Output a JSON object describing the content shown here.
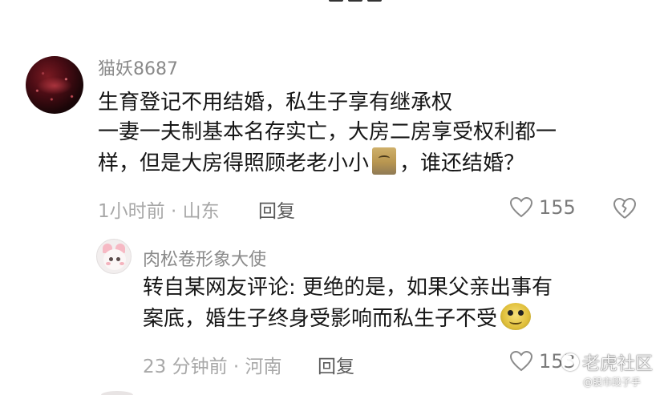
{
  "comments": [
    {
      "username": "猫妖8687",
      "lines": [
        "生育登记不用结婚，私生子享有继承权",
        "一妻一夫制基本名存实亡，大房二房享受权利都一",
        "样，但是大房得照顾老老小小",
        "，谁还结婚？"
      ],
      "time_location": "1小时前 · 山东",
      "reply_label": "回复",
      "like_count": "155"
    },
    {
      "username": "肉松卷形象大使",
      "lines": [
        "转自某网友评论: 更绝的是，如果父亲出事有",
        "案底，婚生子终身受影响而私生子不受"
      ],
      "time_location": "23 分钟前 · 河南",
      "reply_label": "回复",
      "like_count": "153"
    }
  ],
  "watermark": {
    "main": "老虎社区",
    "sub": "@股市段子手"
  },
  "icons": {
    "like": "heart-outline-icon",
    "dislike": "broken-heart-icon",
    "watermark": "tiger-community-logo-icon"
  }
}
